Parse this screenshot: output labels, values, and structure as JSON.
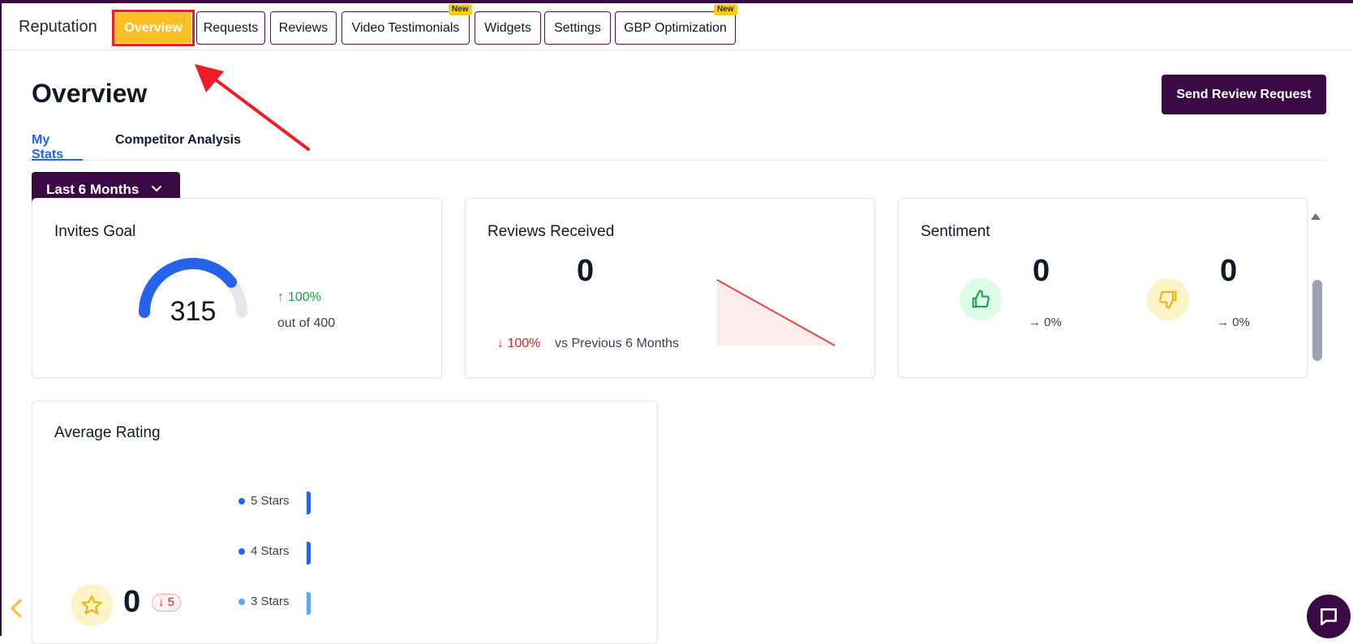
{
  "nav": {
    "brand": "Reputation",
    "tabs": [
      {
        "label": "Overview"
      },
      {
        "label": "Requests"
      },
      {
        "label": "Reviews"
      },
      {
        "label": "Video Testimonials",
        "badge": "New"
      },
      {
        "label": "Widgets"
      },
      {
        "label": "Settings"
      },
      {
        "label": "GBP Optimization",
        "badge": "New"
      }
    ]
  },
  "header": {
    "title": "Overview",
    "primary_button": "Send Review Request"
  },
  "subtabs": [
    "My Stats",
    "Competitor Analysis"
  ],
  "range_selector": {
    "selected": "Last 6 Months"
  },
  "invites_goal": {
    "title": "Invites Goal",
    "value": "315",
    "change": "100%",
    "goal_text": "out of 400",
    "progress_fraction": 0.7875
  },
  "reviews_received": {
    "title": "Reviews Received",
    "value": "0",
    "change": "100%",
    "compare_text": "vs Previous 6 Months"
  },
  "sentiment": {
    "title": "Sentiment",
    "positive_value": "0",
    "positive_change": "0%",
    "negative_value": "0",
    "negative_change": "0%"
  },
  "average_rating": {
    "title": "Average Rating",
    "value": "0",
    "change": "5",
    "rows": [
      {
        "label": "5 Stars"
      },
      {
        "label": "4 Stars"
      },
      {
        "label": "3 Stars"
      }
    ]
  },
  "colors": {
    "brand_purple": "#3b0a45",
    "accent_yellow": "#fbbf24",
    "link_blue": "#2563eb",
    "up_green": "#16a34a",
    "down_red": "#dc2626"
  }
}
